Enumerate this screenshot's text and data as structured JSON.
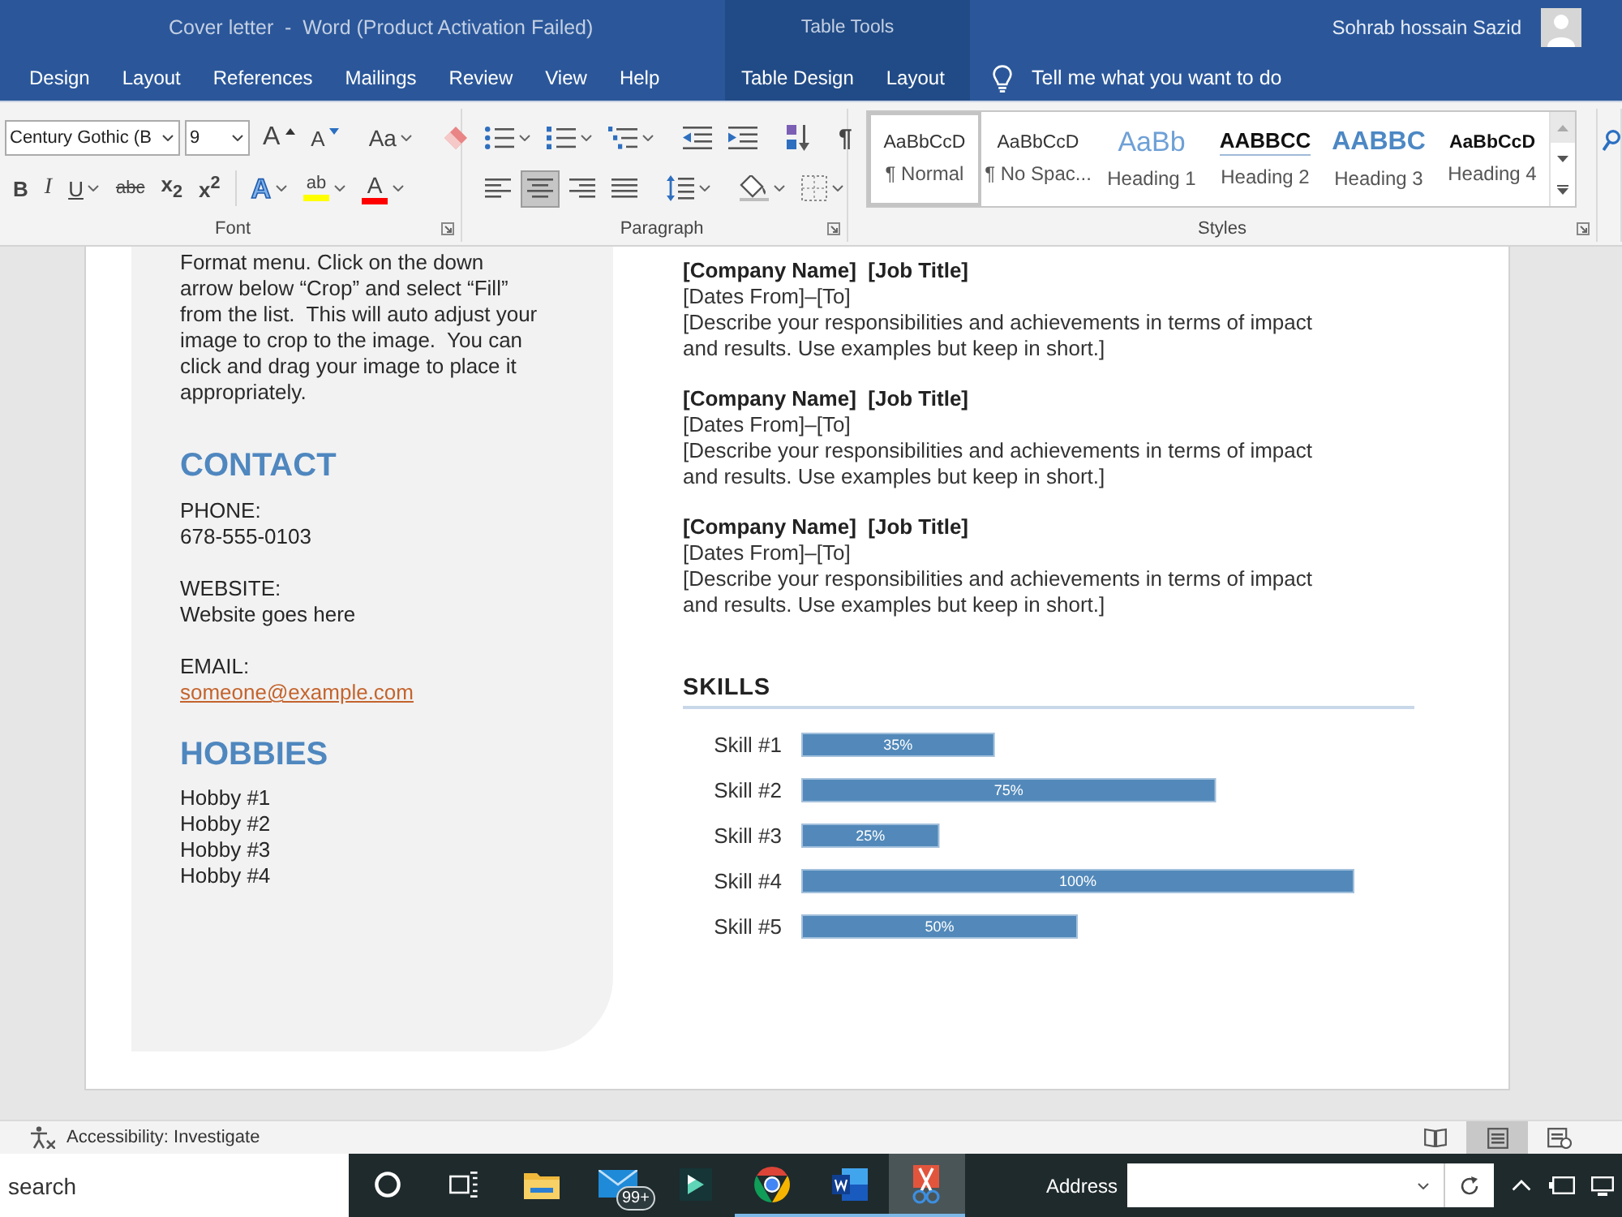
{
  "window": {
    "title": "Cover letter  -  Word (Product Activation Failed)",
    "user": "Sohrab hossain Sazid"
  },
  "tabs": [
    {
      "label": "Design"
    },
    {
      "label": "Layout"
    },
    {
      "label": "References"
    },
    {
      "label": "Mailings"
    },
    {
      "label": "Review"
    },
    {
      "label": "View"
    },
    {
      "label": "Help"
    }
  ],
  "table_tools": {
    "title": "Table Tools",
    "tabs": [
      {
        "label": "Table Design"
      },
      {
        "label": "Layout"
      }
    ]
  },
  "tell_me": "Tell me what you want to do",
  "font_group": {
    "label": "Font",
    "font_name": "Century Gothic (B",
    "font_size": "9",
    "row_1": [
      {
        "kind": "grow",
        "label": "A",
        "menu": false
      },
      {
        "kind": "shrink",
        "label": "A",
        "menu": false
      },
      {
        "kind": "separator"
      },
      {
        "kind": "change-case",
        "label": "Aa",
        "menu": true
      },
      {
        "kind": "separator"
      },
      {
        "kind": "clear-format",
        "menu": false
      }
    ],
    "row_2": [
      {
        "kind": "bold",
        "label": "B",
        "menu": false
      },
      {
        "kind": "italic",
        "label": "I",
        "menu": false
      },
      {
        "kind": "underline",
        "label": "U",
        "menu": true
      },
      {
        "kind": "strikethrough",
        "label": "abc",
        "menu": false
      },
      {
        "kind": "subscript",
        "label": "x$_{2}$",
        "menu": false
      },
      {
        "kind": "superscript",
        "label": "x$^{2}$",
        "menu": false
      },
      {
        "kind": "separator"
      },
      {
        "kind": "text-effects",
        "label": "A",
        "menu": true
      },
      {
        "kind": "highlight",
        "label": "ab",
        "color": "#ffff00",
        "menu": true
      },
      {
        "kind": "font-color",
        "label": "A",
        "color": "#ff0000",
        "menu": true
      }
    ]
  },
  "paragraph_group": {
    "label": "Paragraph",
    "row_1": [
      {
        "kind": "bullets",
        "menu": true
      },
      {
        "kind": "numbering",
        "menu": true
      },
      {
        "kind": "multilevel",
        "menu": true
      },
      {
        "kind": "separator"
      },
      {
        "kind": "outdent",
        "menu": false
      },
      {
        "kind": "indent",
        "menu": false
      },
      {
        "kind": "separator"
      },
      {
        "kind": "sort",
        "menu": false
      },
      {
        "kind": "separator"
      },
      {
        "kind": "pilcrow",
        "label": "¶",
        "menu": false
      }
    ],
    "row_2": [
      {
        "kind": "align-left",
        "selected": false,
        "menu": false
      },
      {
        "kind": "align-center",
        "selected": true,
        "menu": false
      },
      {
        "kind": "align-right",
        "selected": false,
        "menu": false
      },
      {
        "kind": "justify",
        "selected": false,
        "menu": false
      },
      {
        "kind": "separator"
      },
      {
        "kind": "line-spacing",
        "selected": false,
        "menu": true
      },
      {
        "kind": "separator"
      },
      {
        "kind": "shading",
        "selected": false,
        "menu": true
      },
      {
        "kind": "borders",
        "selected": false,
        "menu": true
      }
    ]
  },
  "styles_group": {
    "label": "Styles",
    "items": [
      {
        "kind": "normal",
        "preview": "AaBbCcD",
        "name": "¶ Normal",
        "selected": true
      },
      {
        "kind": "no-spacing",
        "preview": "AaBbCcD",
        "name": "¶ No Spac...",
        "selected": false
      },
      {
        "kind": "heading-1",
        "preview": "AaBb",
        "name": "Heading 1",
        "selected": false
      },
      {
        "kind": "heading-2",
        "preview": "AABBCC",
        "name": "Heading 2",
        "selected": false
      },
      {
        "kind": "heading-3",
        "preview": "AABBC",
        "name": "Heading 3",
        "selected": false
      },
      {
        "kind": "heading-4",
        "preview": "AaBbCcD",
        "name": "Heading 4",
        "selected": false
      }
    ]
  },
  "sidebar": {
    "intro_lines": [
      "Format menu. Click on the down",
      "arrow below “Crop” and select “Fill”",
      "from the list.  This will auto adjust your",
      "image to crop to the image.  You can",
      "click and drag your image to place it",
      "appropriately."
    ],
    "contact": {
      "heading": "CONTACT",
      "fields": [
        {
          "label": "PHONE:",
          "value": "678-555-0103",
          "kind": "text"
        },
        {
          "label": "WEBSITE:",
          "value": "Website goes here",
          "kind": "text"
        },
        {
          "label": "EMAIL:",
          "value": "someone@example.com",
          "kind": "link"
        }
      ]
    },
    "hobbies": {
      "heading": "HOBBIES",
      "items": [
        "Hobby #1",
        "Hobby #2",
        "Hobby #3",
        "Hobby #4"
      ]
    }
  },
  "experience": [
    {
      "heading": "[Company Name]  [Job Title]",
      "dates": "[Dates From]–[To]",
      "description_lines": [
        "[Describe your responsibilities and achievements in terms of impact",
        "and results. Use examples but keep in short.]"
      ]
    },
    {
      "heading": "[Company Name]  [Job Title]",
      "dates": "[Dates From]–[To]",
      "description_lines": [
        "[Describe your responsibilities and achievements in terms of impact",
        "and results. Use examples but keep in short.]"
      ]
    },
    {
      "heading": "[Company Name]  [Job Title]",
      "dates": "[Dates From]–[To]",
      "description_lines": [
        "[Describe your responsibilities and achievements in terms of impact",
        "and results. Use examples but keep in short.]"
      ]
    }
  ],
  "skills": {
    "heading": "SKILLS",
    "chart_data": {
      "type": "bar",
      "orientation": "horizontal",
      "categories": [
        "Skill #1",
        "Skill #2",
        "Skill #3",
        "Skill #4",
        "Skill #5"
      ],
      "values": [
        35,
        75,
        25,
        100,
        50
      ],
      "xlim": [
        0,
        100
      ],
      "value_labels": [
        "35%",
        "75%",
        "25%",
        "100%",
        "50%"
      ]
    }
  },
  "status_bar": {
    "accessibility": "Accessibility: Investigate",
    "views": [
      {
        "kind": "read",
        "selected": false
      },
      {
        "kind": "print",
        "selected": true
      },
      {
        "kind": "web",
        "selected": false
      }
    ]
  },
  "taskbar": {
    "search": {
      "placeholder": "search"
    },
    "apps": [
      {
        "kind": "cortana",
        "open": false,
        "selected": false
      },
      {
        "kind": "task-view",
        "open": false,
        "selected": false
      },
      {
        "kind": "explorer",
        "open": false,
        "selected": false
      },
      {
        "kind": "mail",
        "badge": "99+",
        "open": false,
        "selected": false
      },
      {
        "kind": "video-editor",
        "open": false,
        "selected": false
      },
      {
        "kind": "browser",
        "open": true,
        "selected": false
      },
      {
        "kind": "word",
        "open": true,
        "selected": false
      },
      {
        "kind": "scissors",
        "open": true,
        "selected": true
      }
    ],
    "address": {
      "label": "Address"
    }
  }
}
